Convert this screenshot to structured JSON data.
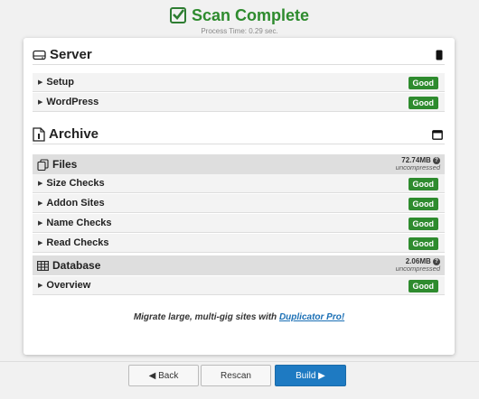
{
  "header": {
    "title": "Scan Complete",
    "subtitle": "Process Time: 0.29 sec."
  },
  "server": {
    "title": "Server",
    "rows": [
      {
        "label": "Setup",
        "status": "Good"
      },
      {
        "label": "WordPress",
        "status": "Good"
      }
    ]
  },
  "archive": {
    "title": "Archive",
    "files": {
      "label": "Files",
      "size": "72.74MB",
      "size_note": "uncompressed",
      "rows": [
        {
          "label": "Size Checks",
          "status": "Good"
        },
        {
          "label": "Addon Sites",
          "status": "Good"
        },
        {
          "label": "Name Checks",
          "status": "Good"
        },
        {
          "label": "Read Checks",
          "status": "Good"
        }
      ]
    },
    "database": {
      "label": "Database",
      "size": "2.06MB",
      "size_note": "uncompressed",
      "rows": [
        {
          "label": "Overview",
          "status": "Good"
        }
      ]
    }
  },
  "promo": {
    "text": "Migrate large, multi-gig sites with ",
    "link": "Duplicator Pro!"
  },
  "buttons": {
    "back": "◀ Back",
    "rescan": "Rescan",
    "build": "Build ▶"
  },
  "colors": {
    "success": "#2e8b2e",
    "primary": "#1e7ac2"
  }
}
